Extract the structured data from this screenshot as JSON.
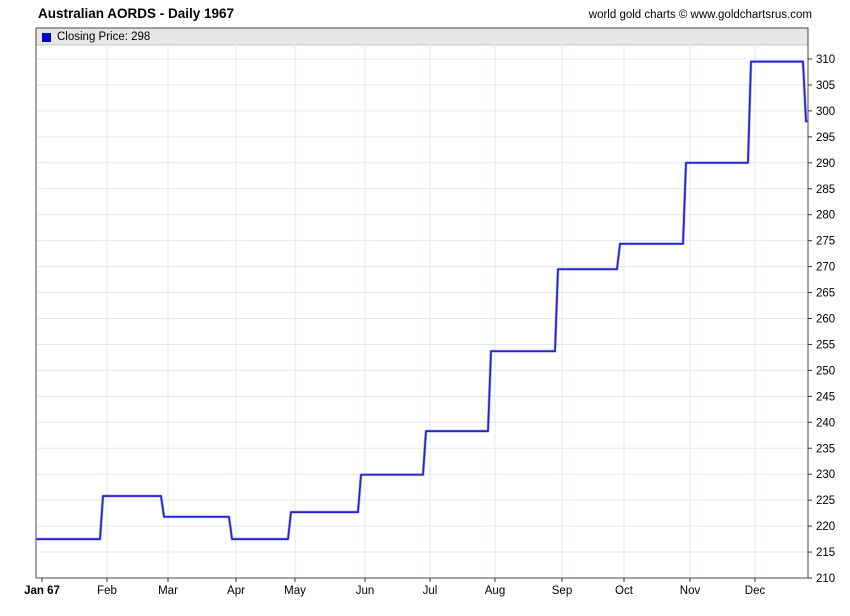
{
  "header": {
    "title": "Australian AORDS - Daily 1967",
    "copyright": "world gold charts © www.goldchartsrus.com"
  },
  "legend": {
    "label": "Closing Price: 298",
    "marker_color": "#0000cc"
  },
  "chart_data": {
    "type": "line",
    "line_style": "step",
    "title": "Australian AORDS - Daily 1967",
    "series_name": "Closing Price",
    "x_tick_labels": [
      "Jan 67",
      "Feb",
      "Mar",
      "Apr",
      "May",
      "Jun",
      "Jul",
      "Aug",
      "Sep",
      "Oct",
      "Nov",
      "Dec"
    ],
    "monthly_close": [
      217.5,
      225.8,
      221.8,
      217.5,
      222.7,
      229.9,
      238.3,
      253.7,
      269.5,
      274.4,
      290,
      309.5
    ],
    "year_end_close": 298,
    "ylim": [
      210,
      310
    ],
    "y_tick_step": 5,
    "y_tick_labels": [
      "210",
      "215",
      "220",
      "225",
      "230",
      "235",
      "240",
      "245",
      "250",
      "255",
      "260",
      "265",
      "270",
      "275",
      "280",
      "285",
      "290",
      "295",
      "300",
      "305",
      "310"
    ],
    "y_axis_side": "right",
    "grid": true,
    "legend_position": "top-left-strip",
    "colors": {
      "line": "#2323cb",
      "line_glow": "#9a9aec",
      "legend_marker": "#0000cc",
      "grid": "#dfe9f5",
      "legend_strip_bg": "#e7e7e7",
      "frame": "#4a4a4a",
      "tick": "#333333"
    }
  }
}
